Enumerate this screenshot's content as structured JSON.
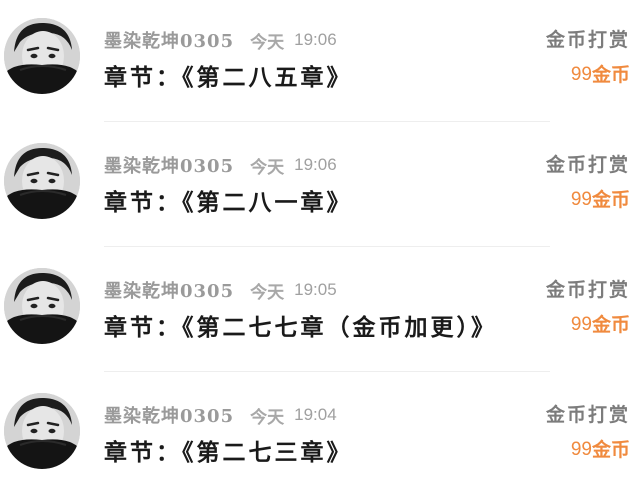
{
  "rewards": [
    {
      "username": "墨染乾坤0305",
      "date": "今天",
      "time": "19:06",
      "chapter": "章节：《第二八五章》",
      "reward_label": "金币打赏",
      "amount": "99",
      "unit": "金币"
    },
    {
      "username": "墨染乾坤0305",
      "date": "今天",
      "time": "19:06",
      "chapter": "章节：《第二八一章》",
      "reward_label": "金币打赏",
      "amount": "99",
      "unit": "金币"
    },
    {
      "username": "墨染乾坤0305",
      "date": "今天",
      "time": "19:05",
      "chapter": "章节：《第二七七章（金币加更）》",
      "reward_label": "金币打赏",
      "amount": "99",
      "unit": "金币"
    },
    {
      "username": "墨染乾坤0305",
      "date": "今天",
      "time": "19:04",
      "chapter": "章节：《第二七三章》",
      "reward_label": "金币打赏",
      "amount": "99",
      "unit": "金币"
    }
  ],
  "colors": {
    "amount": "#f08a3e",
    "chapter_text": "#1a1a1a",
    "meta_text": "#9a9a9a",
    "label_text": "#7c7c7c"
  },
  "icons": {
    "avatar": "user-avatar-photo"
  }
}
